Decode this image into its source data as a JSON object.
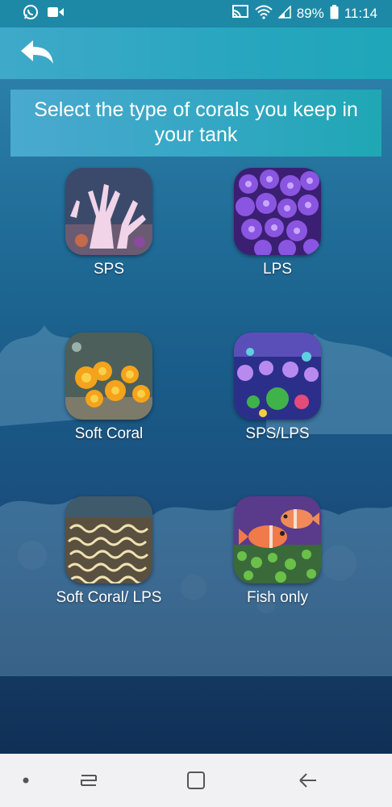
{
  "status_bar": {
    "battery": "89%",
    "time": "11:14",
    "icons": [
      "whatsapp-icon",
      "video-call-icon",
      "cast-icon",
      "wifi-icon",
      "signal-icon",
      "battery-icon"
    ]
  },
  "app_bar": {
    "back_icon": "back-arrow-icon"
  },
  "banner": {
    "title": "Select the type of corals you keep in your tank"
  },
  "coral_types": [
    {
      "label": "SPS",
      "icon": "sps-coral-image"
    },
    {
      "label": "LPS",
      "icon": "lps-coral-image"
    },
    {
      "label": "Soft Coral",
      "icon": "soft-coral-image"
    },
    {
      "label": "SPS/LPS",
      "icon": "sps-lps-image"
    },
    {
      "label": "Soft Coral/ LPS",
      "icon": "soft-coral-lps-image"
    },
    {
      "label": "Fish only",
      "icon": "fish-only-image"
    }
  ],
  "nav_bar": {
    "items": [
      "dot-icon",
      "recent-apps-icon",
      "home-icon",
      "back-icon"
    ]
  },
  "colors": {
    "status_bar": "#1e89a6",
    "app_bar": "#28a6bf",
    "banner": "#34a7c4",
    "ocean_top": "#2a7fa8",
    "ocean_bottom": "#102f55",
    "nav_bar": "#f1f1f3"
  }
}
